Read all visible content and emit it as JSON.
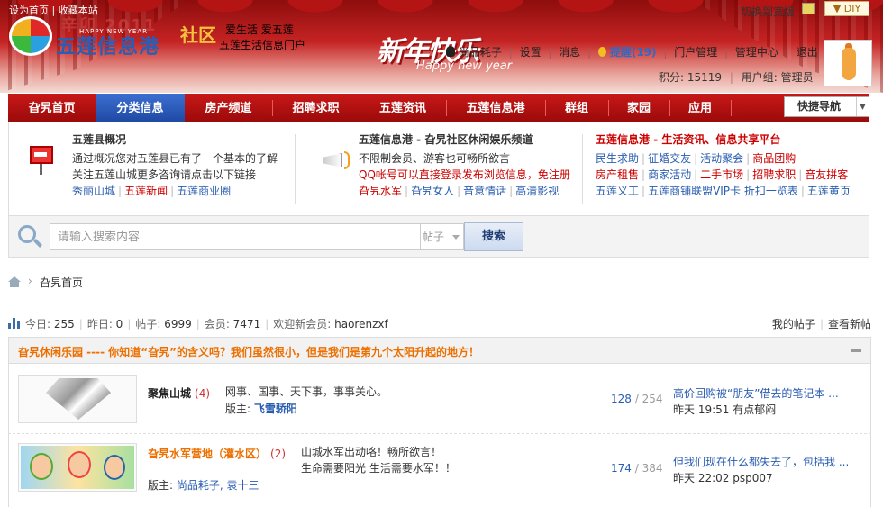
{
  "header": {
    "top_links": "设为首页 | 收藏本站",
    "logo_year": "辛卯 2011",
    "logo_happy": "HAPPY NEW YEAR",
    "logo_name": "五莲信息港",
    "logo_shequ": "社区",
    "slogan_line1": "爱生活 爱五莲",
    "slogan_line2": "五莲生活信息门户",
    "banner_title": "新年快乐",
    "banner_sub": "Happy new year",
    "switch_skin": "切换到宽版",
    "diy": "DIY",
    "user_links": {
      "qq_text": "尚品耗",
      "bind": "子",
      "settings": "设置",
      "messages": "消息",
      "remind": "提醒(19)",
      "portal_admin": "门户管理",
      "admin_center": "管理中心",
      "logout": "退出"
    },
    "credit_label": "积分: ",
    "credit_value": "15119",
    "usergroup_label": "用户组: ",
    "usergroup_value": "管理员"
  },
  "nav": {
    "items": [
      "旮旯首页",
      "分类信息",
      "房产频道",
      "招聘求职",
      "五莲资讯",
      "五莲信息港",
      "群组",
      "家园",
      "应用"
    ],
    "active_index": 1,
    "quick_nav": "快捷导航",
    "quick_nav_arrow": "▼"
  },
  "info": {
    "col1": {
      "title": "五莲县概况",
      "line1": "通过概况您对五莲县已有了一个基本的了解",
      "line2": "关注五莲山城更多咨询请点击以下链接",
      "links": [
        "秀丽山城",
        "五莲新闻",
        "五莲商业圈"
      ]
    },
    "col2": {
      "title": "五莲信息港 - 旮旯社区休闲娱乐频道",
      "line1": "不限制会员、游客也可畅所欲言",
      "line2": "QQ帐号可以直接登录发布浏览信息，免注册",
      "links": [
        "旮旯水军",
        "旮旯女人",
        "音意情话",
        "高清影视"
      ]
    },
    "col3": {
      "title": "五莲信息港 - 生活资讯、信息共享平台",
      "row1": [
        "民生求助",
        "征婚交友",
        "活动聚会",
        "商品团购"
      ],
      "row2": [
        "房产租售",
        "商家活动",
        "二手市场",
        "招聘求职",
        "音友拼客"
      ],
      "row3": [
        "五莲义工",
        "五莲商铺联盟VIP卡 折扣一览表",
        "五莲黄页"
      ]
    }
  },
  "search": {
    "placeholder": "请输入搜索内容",
    "type": "帖子",
    "button": "搜索"
  },
  "breadcrumb": {
    "sep": "›",
    "current": "旮旯首页"
  },
  "stats": {
    "today_label": "今日: ",
    "today": "255",
    "yesterday_label": "昨日: ",
    "yesterday": "0",
    "posts_label": "帖子: ",
    "posts": "6999",
    "members_label": "会员: ",
    "members": "7471",
    "newest_label": "欢迎新会员: ",
    "newest": "haorenzxf",
    "my_posts": "我的帖子",
    "new_posts": "查看新帖"
  },
  "group": {
    "title": "旮旯休闲乐园 ---- 你知道“旮旯”的含义吗？我们虽然很小，但是我们是第九个太阳升起的地方！"
  },
  "forums": [
    {
      "name": "聚焦山城",
      "today_count": "(4)",
      "desc": "网事、国事、天下事，事事关心。",
      "mod_label": "版主: ",
      "mod": "飞雪骄阳",
      "threads": "128",
      "posts": "254",
      "last_title": "高价回购被“朋友”借去的笔记本 ...",
      "last_time": "昨天 19:51",
      "last_user": "有点郁闷"
    },
    {
      "name": "旮旯水军营地（灌水区）",
      "today_count": "(2)",
      "desc_line1": "山城水军出动咯！畅所欲言！",
      "desc_line2": "生命需要阳光 生活需要水军！！",
      "mod_label": "版主: ",
      "mod": "尚品耗子, 袁十三",
      "threads": "174",
      "posts": "384",
      "last_title": "但我们现在什么都失去了，包括我 ...",
      "last_time": "昨天 22:02",
      "last_user": "psp007"
    }
  ],
  "count_sep": " / "
}
